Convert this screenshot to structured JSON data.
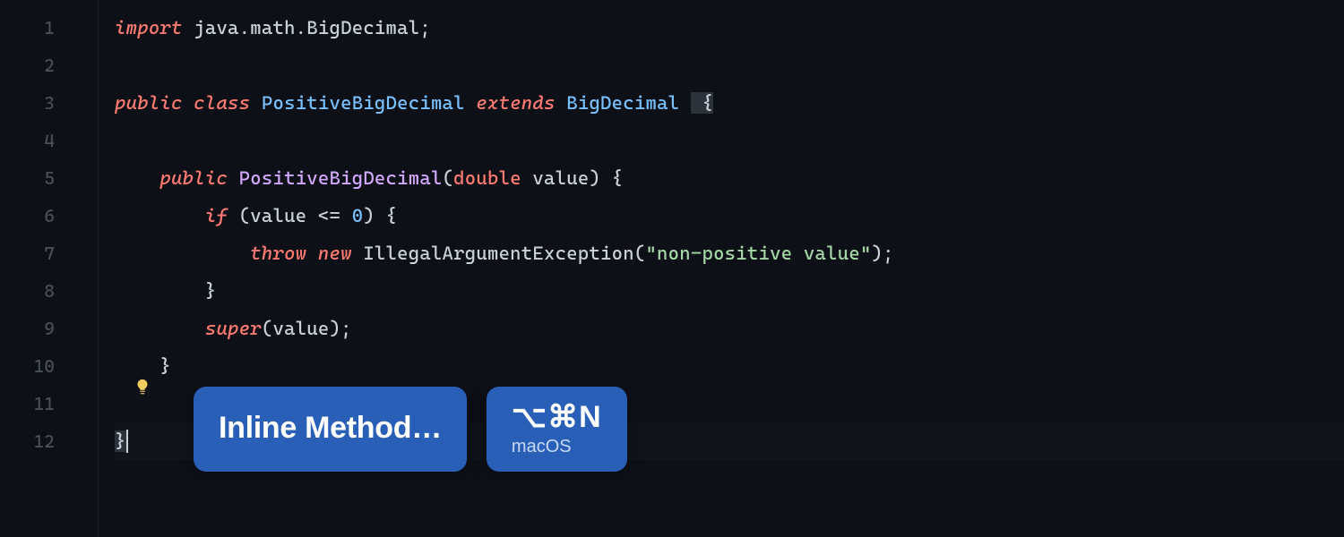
{
  "lineNumbers": [
    "1",
    "2",
    "3",
    "4",
    "5",
    "6",
    "7",
    "8",
    "9",
    "10",
    "11",
    "12"
  ],
  "code": {
    "l1": {
      "t1": "import",
      "t2": " java.math.BigDecimal",
      "t3": ";"
    },
    "l3": {
      "t1": "public",
      "t2": " class",
      "t3": " PositiveBigDecimal",
      "t4": " extends",
      "t5": " BigDecimal",
      "t6": " {"
    },
    "l5": {
      "indent": "    ",
      "t1": "public",
      "t2": " PositiveBigDecimal",
      "t3": "(",
      "t4": "double",
      "t5": " value",
      "t6": ")",
      "t7": " {"
    },
    "l6": {
      "indent": "        ",
      "t1": "if",
      "t2": " (value ",
      "t3": "<=",
      "t4": " ",
      "t5": "0",
      "t6": ")",
      "t7": " {"
    },
    "l7": {
      "indent": "            ",
      "t1": "throw",
      "t2": " new",
      "t3": " IllegalArgumentException",
      "t4": "(",
      "t5": "\"non-positive value\"",
      "t6": ")",
      "t7": ";"
    },
    "l8": {
      "indent": "        ",
      "t1": "}"
    },
    "l9": {
      "indent": "        ",
      "t1": "super",
      "t2": "(value)",
      "t3": ";"
    },
    "l10": {
      "indent": "    ",
      "t1": "}"
    },
    "l12": {
      "t1": "}"
    }
  },
  "popup": {
    "action": "Inline Method…",
    "shortcut": "⌥⌘N",
    "platform": "macOS"
  },
  "colors": {
    "popupBg": "#2a5fb8",
    "kw": "#ff7b72",
    "cls": "#79c0ff",
    "str": "#a5d6a7"
  }
}
